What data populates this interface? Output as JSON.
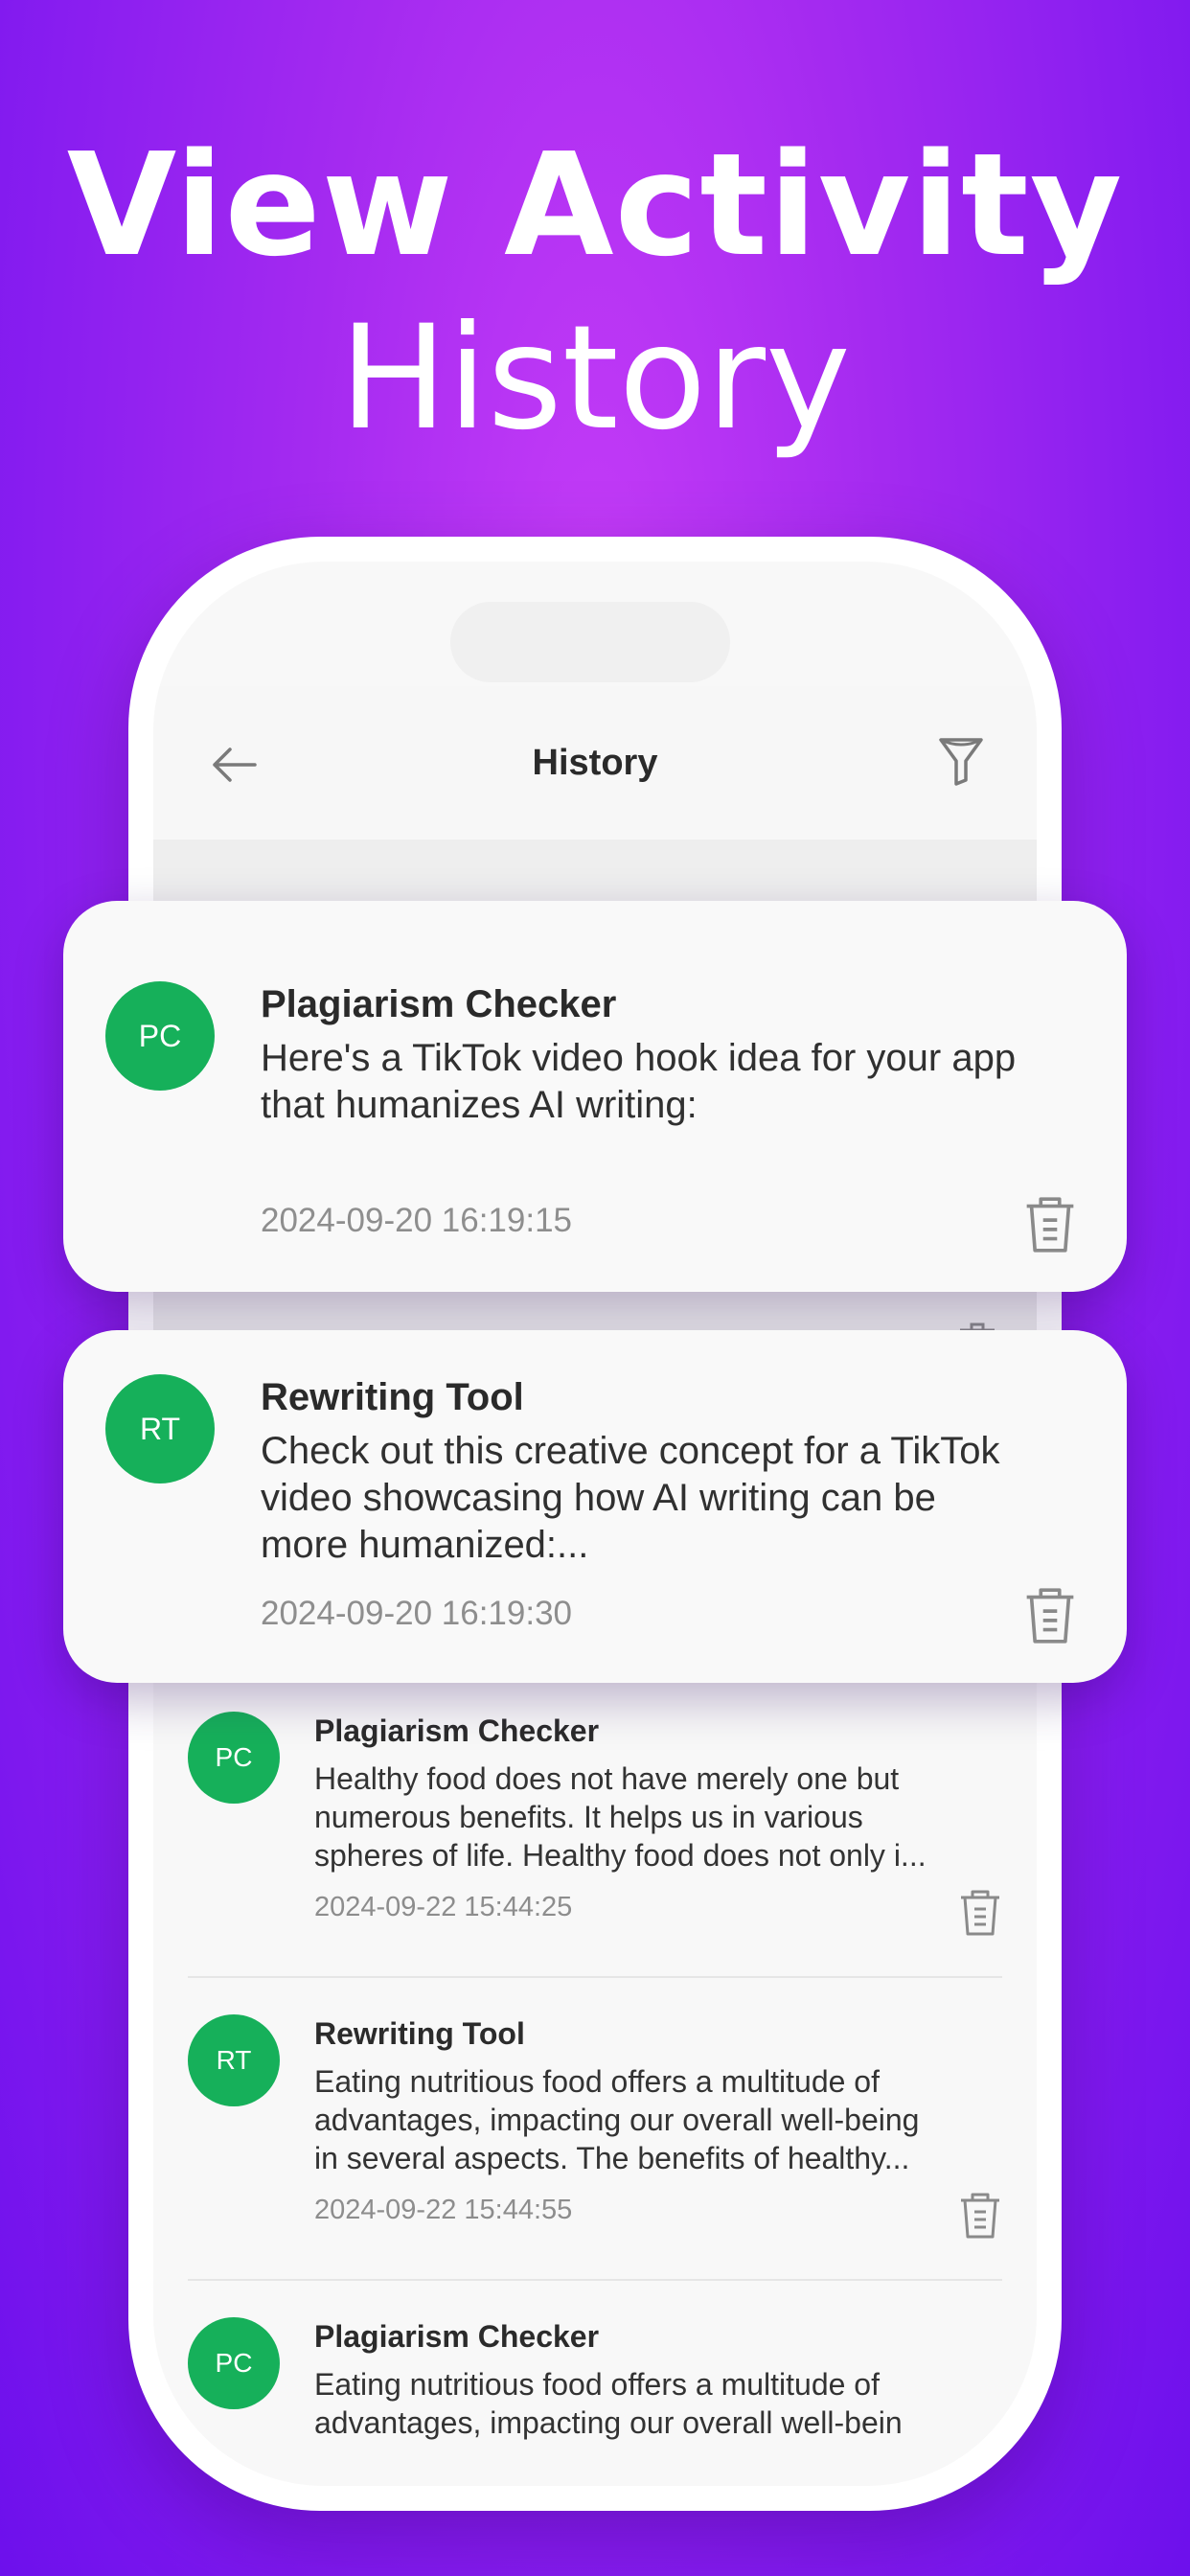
{
  "headline": {
    "line1": "View Activity",
    "line2": "History"
  },
  "header": {
    "title": "History",
    "back_icon": "arrow-left-icon",
    "filter_icon": "filter-icon"
  },
  "featured": [
    {
      "initials": "PC",
      "tool": "Plagiarism Checker",
      "desc": [
        "Here's a TikTok video hook idea for your app",
        "that humanizes AI writing:"
      ],
      "date": "2024-09-20 16:19:15"
    },
    {
      "initials": "RT",
      "tool": "Rewriting Tool",
      "desc": [
        "Check out this creative concept for a TikTok",
        "video showcasing how AI writing can be",
        "more humanized:..."
      ],
      "date": "2024-09-20 16:19:30"
    }
  ],
  "history": [
    {
      "initials": "PC",
      "tool": "Plagiarism Checker",
      "desc": [
        "Healthy food does not have merely one but",
        "numerous benefits. It helps us in various",
        "spheres of life. Healthy food does not only i..."
      ],
      "date": "2024-09-22 15:44:25"
    },
    {
      "initials": "RT",
      "tool": "Rewriting Tool",
      "desc": [
        "Eating nutritious food offers a multitude of",
        "advantages, impacting our overall well-being",
        "in several aspects. The benefits of healthy..."
      ],
      "date": "2024-09-22 15:44:55"
    },
    {
      "initials": "PC",
      "tool": "Plagiarism Checker",
      "desc": [
        "Eating nutritious food offers a multitude of",
        "advantages, impacting our overall well-bein"
      ],
      "date": ""
    }
  ],
  "colors": {
    "avatar": "#16b05a",
    "background_top": "#c53cf7",
    "background_bottom": "#6d10ec"
  }
}
